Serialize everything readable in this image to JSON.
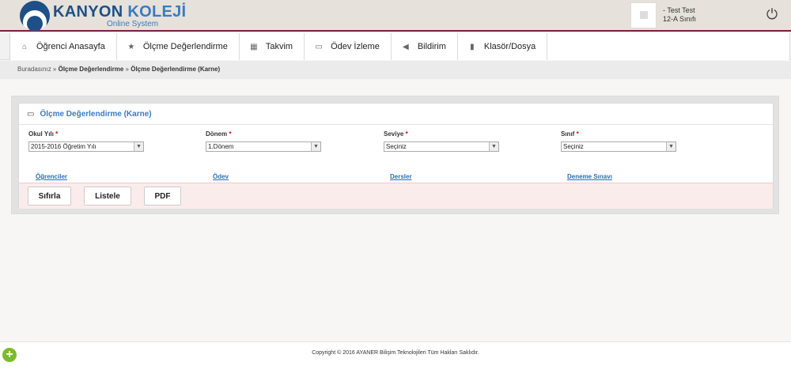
{
  "app": {
    "logo_title_1": "KANYON",
    "logo_title_2": "KOLEJİ",
    "logo_subtitle": "Online System",
    "brand_color": "#1e4f86",
    "accent_color": "#7a1f3d"
  },
  "user": {
    "name": "- Test Test",
    "class": "12-A Sınıfı",
    "avatar_icon": "user-placeholder-icon",
    "power_icon": "power-icon"
  },
  "nav": {
    "items": [
      {
        "label": "Öğrenci Anasayfa",
        "icon": "home-icon",
        "glyph": "⌂"
      },
      {
        "label": "Ölçme Değerlendirme",
        "icon": "star-icon",
        "glyph": "★"
      },
      {
        "label": "Takvim",
        "icon": "calendar-icon",
        "glyph": "▦"
      },
      {
        "label": "Ödev İzleme",
        "icon": "monitor-icon",
        "glyph": "▭"
      },
      {
        "label": "Bildirim",
        "icon": "megaphone-icon",
        "glyph": "◀"
      },
      {
        "label": "Klasör/Dosya",
        "icon": "folder-icon",
        "glyph": "▮"
      }
    ]
  },
  "breadcrumb": {
    "prefix": "Buradasınız »",
    "item1": "Ölçme Değerlendirme",
    "sep": "»",
    "item2": "Ölçme Değerlendirme (Karne)"
  },
  "panel": {
    "title": "Ölçme Değerlendirme (Karne)",
    "title_icon": "monitor-icon"
  },
  "form": {
    "fields": [
      {
        "label": "Okul Yılı",
        "required": "*",
        "value": "2015-2016 Öğretim Yılı"
      },
      {
        "label": "Dönem",
        "required": "*",
        "value": "1.Dönem"
      },
      {
        "label": "Seviye",
        "required": "*",
        "value": "Seçiniz"
      },
      {
        "label": "Sınıf",
        "required": "*",
        "value": "Seçiniz"
      }
    ]
  },
  "links": {
    "students": "Öğrenciler",
    "homework": "Ödev",
    "lessons": "Dersler",
    "trial_exam": "Deneme Sınavı"
  },
  "buttons": {
    "reset": "Sıfırla",
    "list": "Listele",
    "pdf": "PDF"
  },
  "footer": {
    "copyright": "Copyright © 2016 AYANER Bilişim Teknolojileri Tüm Hakları Saklıdır."
  }
}
